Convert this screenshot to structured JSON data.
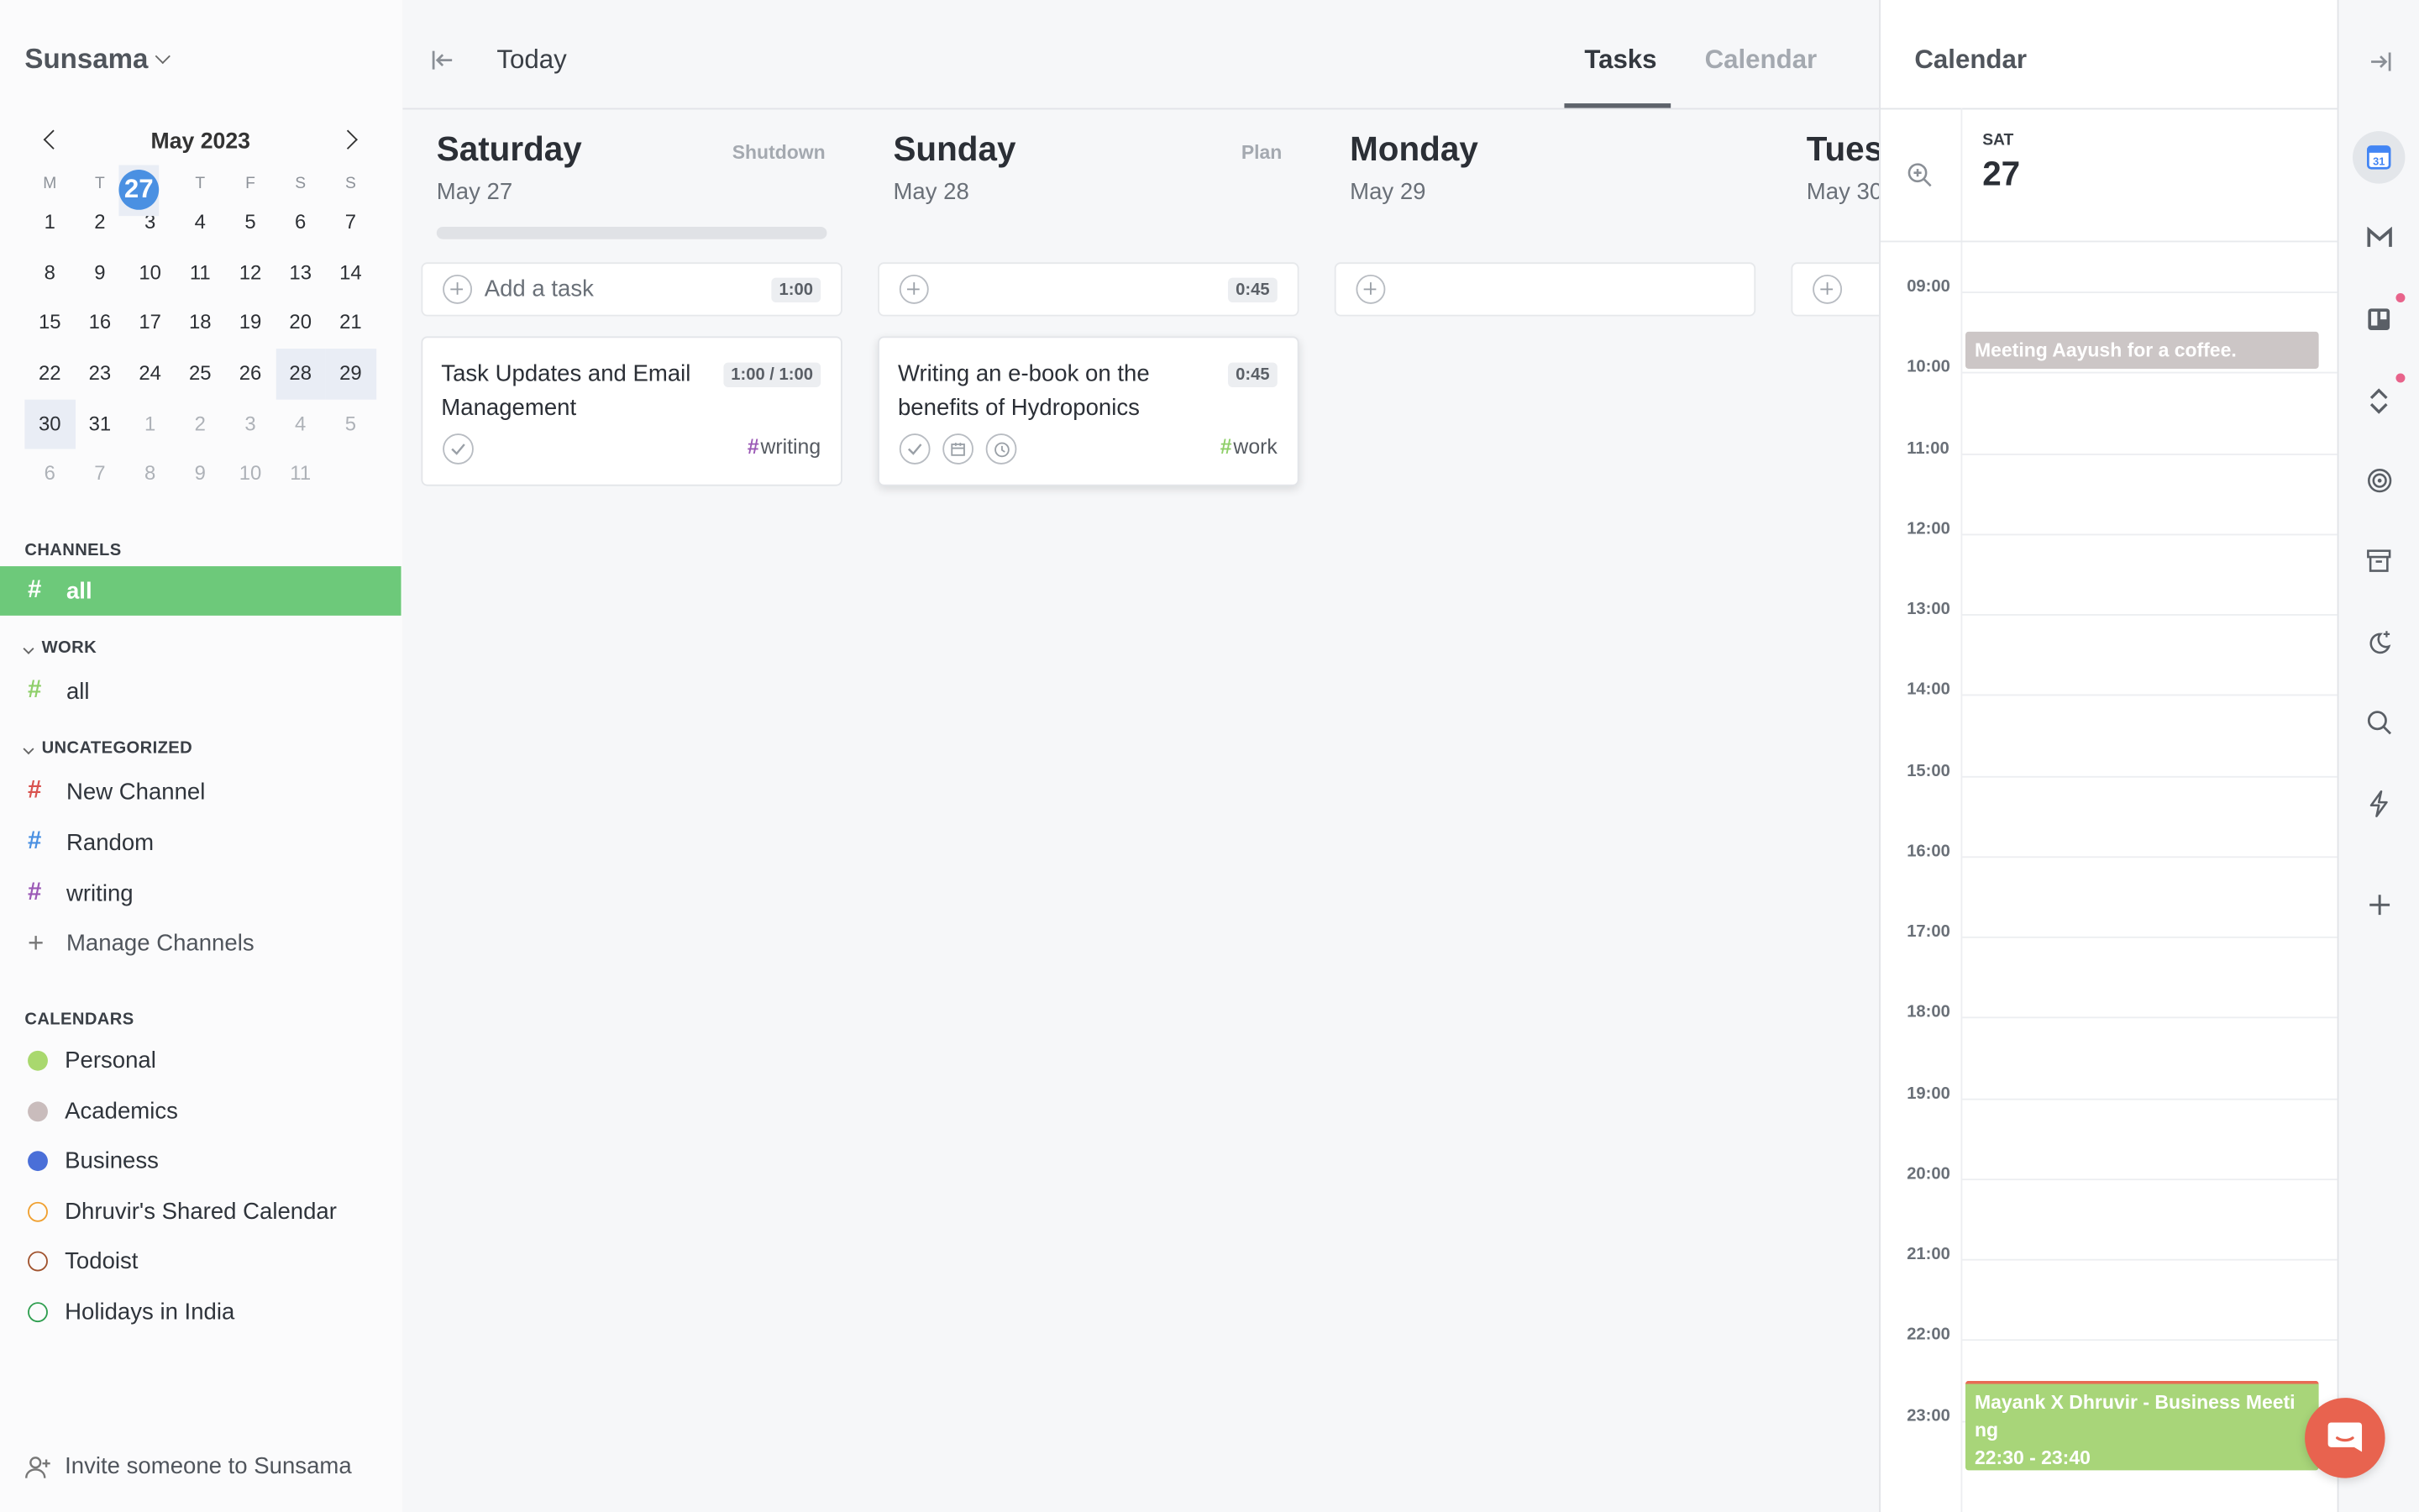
{
  "app": {
    "name": "Sunsama"
  },
  "mini_calendar": {
    "month_label": "May 2023",
    "weekdays": [
      "M",
      "T",
      "W",
      "T",
      "F",
      "S",
      "S"
    ],
    "weeks": [
      [
        "1",
        "2",
        "3",
        "4",
        "5",
        "6",
        "7"
      ],
      [
        "8",
        "9",
        "10",
        "11",
        "12",
        "13",
        "14"
      ],
      [
        "15",
        "16",
        "17",
        "18",
        "19",
        "20",
        "21"
      ],
      [
        "22",
        "23",
        "24",
        "25",
        "26",
        "27",
        "28"
      ],
      [
        "29",
        "30",
        "31",
        "1",
        "2",
        "3",
        "4"
      ],
      [
        "5",
        "6",
        "7",
        "8",
        "9",
        "10",
        "11"
      ]
    ],
    "today": "27"
  },
  "sidebar": {
    "channels_title": "CHANNELS",
    "channels_all": "all",
    "work_title": "WORK",
    "work_all": "all",
    "uncategorized_title": "UNCATEGORIZED",
    "uncategorized": [
      {
        "label": "New Channel",
        "color": "#d9534f"
      },
      {
        "label": "Random",
        "color": "#4a90e2"
      },
      {
        "label": "writing",
        "color": "#9b59b6"
      }
    ],
    "manage_channels": "Manage Channels",
    "calendars_title": "CALENDARS",
    "calendars": [
      {
        "label": "Personal",
        "color": "#a9d86e",
        "filled": true
      },
      {
        "label": "Academics",
        "color": "#c9bcbc",
        "filled": true
      },
      {
        "label": "Business",
        "color": "#4a6fd8",
        "filled": true
      },
      {
        "label": "Dhruvir's Shared Calendar",
        "color": "#f0a030",
        "filled": false
      },
      {
        "label": "Todoist",
        "color": "#a0522d",
        "filled": false
      },
      {
        "label": "Holidays in India",
        "color": "#2e9e4f",
        "filled": false
      }
    ],
    "invite": "Invite someone to Sunsama"
  },
  "header": {
    "today_label": "Today",
    "tabs": [
      "Tasks",
      "Calendar"
    ]
  },
  "days": [
    {
      "name": "Saturday",
      "date": "May 27",
      "action": "Shutdown",
      "add_label": "Add a task",
      "total": "1:00"
    },
    {
      "name": "Sunday",
      "date": "May 28",
      "action": "Plan",
      "add_label": "",
      "total": "0:45"
    },
    {
      "name": "Monday",
      "date": "May 29",
      "action": "",
      "add_label": "",
      "total": ""
    },
    {
      "name": "Tues",
      "date": "May 30",
      "action": "",
      "add_label": "",
      "total": ""
    }
  ],
  "tasks": [
    {
      "title": "Task Updates and Email Management",
      "time": "1:00 / 1:00",
      "tag": "writing",
      "tag_color": "#9b59b6"
    },
    {
      "title": "Writing an e-book on the benefits of Hydroponics",
      "time": "0:45",
      "tag": "work",
      "tag_color": "#8fcf6a"
    }
  ],
  "calendar_panel": {
    "title": "Calendar",
    "day_of_week": "SAT",
    "day_number": "27",
    "hours": [
      "09:00",
      "10:00",
      "11:00",
      "12:00",
      "13:00",
      "14:00",
      "15:00",
      "16:00",
      "17:00",
      "18:00",
      "19:00",
      "20:00",
      "21:00",
      "22:00",
      "23:00"
    ],
    "events": [
      {
        "title": "Meeting Aayush for a coffee.",
        "time": ""
      },
      {
        "title": "Mayank X Dhruvir - Business Meeti ng",
        "time": "22:30 - 23:40"
      }
    ]
  },
  "colors": {
    "accent_green": "#6dc97a",
    "today_blue": "#4a90e2",
    "chat": "#e8634f"
  }
}
